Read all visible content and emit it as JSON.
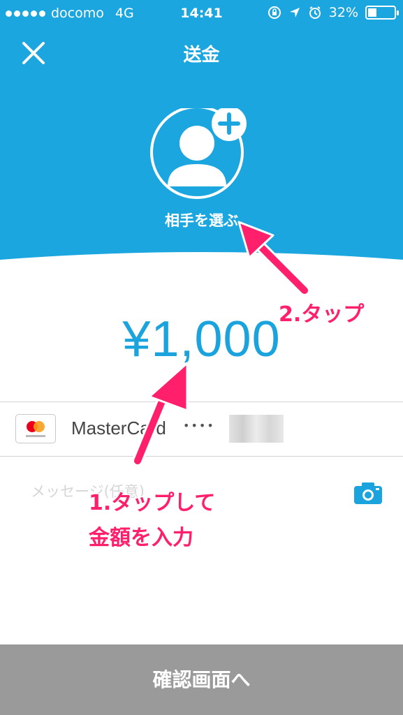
{
  "status_bar": {
    "carrier": "docomo",
    "network": "4G",
    "time": "14:41",
    "battery": "32%",
    "battery_level": 0.32
  },
  "header": {
    "title": "送金",
    "choose_recipient_label": "相手を選ぶ",
    "background_color": "#1ba6df"
  },
  "amount": {
    "value": "¥1,000",
    "color": "#1aa3dd"
  },
  "payment_card": {
    "brand": "MasterCard",
    "masked_number": "••••"
  },
  "message": {
    "placeholder": "メッセージ(任意)"
  },
  "bottom_button": {
    "label": "確認画面へ"
  },
  "annotations": {
    "step1_line1": "1.タップして",
    "step1_line2": "金額を入力",
    "step2": "2.タップ",
    "color": "#ff1f6a"
  }
}
